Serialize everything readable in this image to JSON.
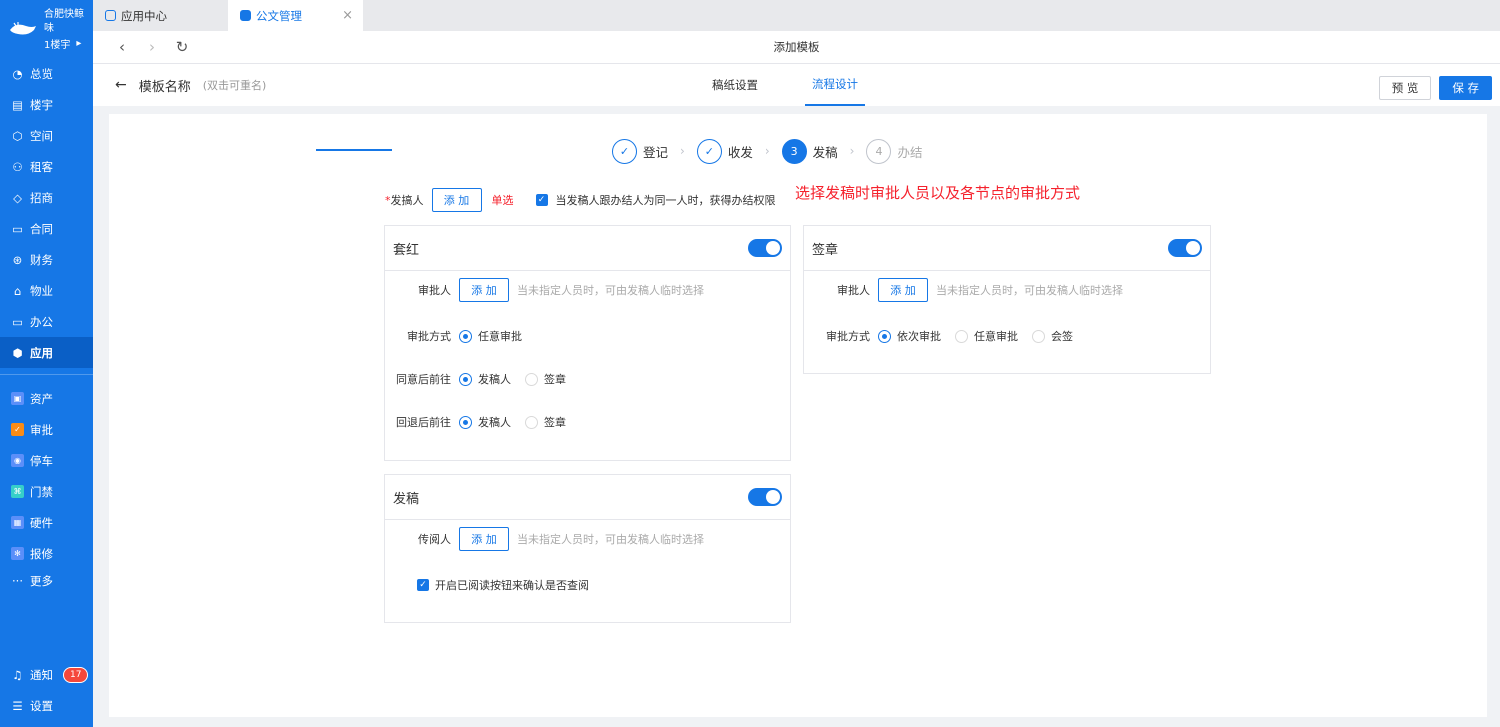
{
  "sidebar": {
    "brand": "合肥快鲸味",
    "building": "1楼宇",
    "items": [
      {
        "label": "总览",
        "icon": "dashboard-icon"
      },
      {
        "label": "楼宇",
        "icon": "building-icon"
      },
      {
        "label": "空间",
        "icon": "cube-icon"
      },
      {
        "label": "租客",
        "icon": "users-icon"
      },
      {
        "label": "招商",
        "icon": "tag-icon"
      },
      {
        "label": "合同",
        "icon": "document-icon"
      },
      {
        "label": "财务",
        "icon": "finance-icon"
      },
      {
        "label": "物业",
        "icon": "home-icon"
      },
      {
        "label": "办公",
        "icon": "monitor-icon"
      },
      {
        "label": "应用",
        "icon": "app-icon"
      }
    ],
    "apps": [
      {
        "label": "资产",
        "color": "#5b8ff9"
      },
      {
        "label": "审批",
        "color": "#fa8c16"
      },
      {
        "label": "停车",
        "color": "#5b8ff9"
      },
      {
        "label": "门禁",
        "color": "#36cfc9"
      },
      {
        "label": "硬件",
        "color": "#5b8ff9"
      },
      {
        "label": "报修",
        "color": "#5b8ff9"
      }
    ],
    "more": "更多",
    "notify": "通知",
    "notify_count": "17",
    "settings": "设置"
  },
  "tabs": [
    {
      "label": "应用中心"
    },
    {
      "label": "公文管理"
    }
  ],
  "toolbar": {
    "title": "添加模板"
  },
  "header": {
    "template_name": "模板名称",
    "template_hint": "(双击可重名)",
    "tabs": [
      "稿纸设置",
      "流程设计"
    ],
    "preview": "预 览",
    "save": "保 存"
  },
  "steps": [
    {
      "num": "",
      "label": "登记"
    },
    {
      "num": "",
      "label": "收发"
    },
    {
      "num": "3",
      "label": "发稿"
    },
    {
      "num": "4",
      "label": "办结"
    }
  ],
  "annotation": "选择发稿时审批人员以及各节点的审批方式",
  "issuer": {
    "label": "发搞人",
    "add": "添 加",
    "single": "单选",
    "checkbox": "当发稿人跟办结人为同一人时，获得办结权限"
  },
  "cards": {
    "taohong": {
      "title": "套红",
      "approver_label": "审批人",
      "add": "添 加",
      "hint": "当未指定人员时，可由发稿人临时选择",
      "method_label": "审批方式",
      "method_opt": "任意审批",
      "agree_label": "同意后前往",
      "agree_opts": [
        "发稿人",
        "签章"
      ],
      "back_label": "回退后前往",
      "back_opts": [
        "发稿人",
        "签章"
      ]
    },
    "qianzhang": {
      "title": "签章",
      "approver_label": "审批人",
      "add": "添 加",
      "hint": "当未指定人员时，可由发稿人临时选择",
      "method_label": "审批方式",
      "method_opts": [
        "依次审批",
        "任意审批",
        "会签"
      ]
    },
    "fagao": {
      "title": "发稿",
      "reader_label": "传阅人",
      "add": "添 加",
      "hint": "当未指定人员时，可由发稿人临时选择",
      "checkbox": "开启已阅读按钮来确认是否查阅"
    }
  }
}
